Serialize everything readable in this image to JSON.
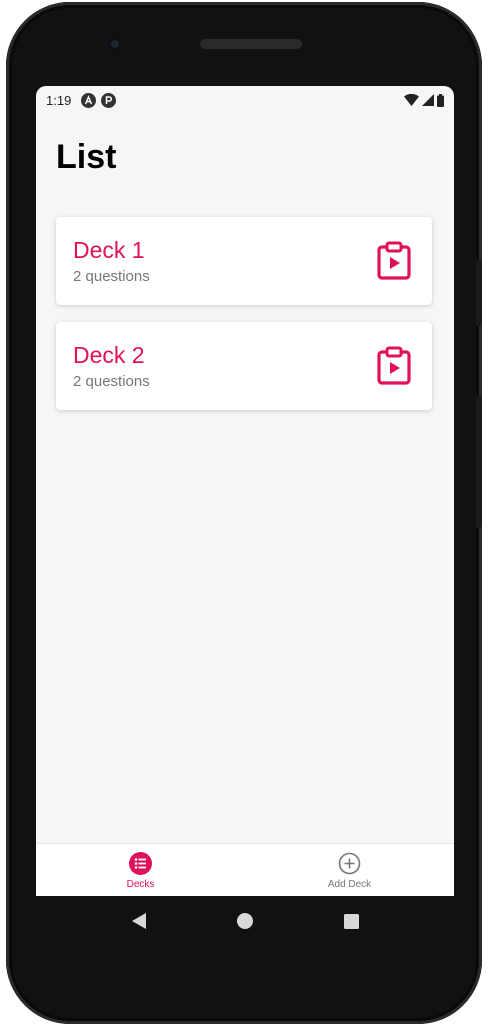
{
  "status_bar": {
    "time": "1:19"
  },
  "header": {
    "title": "List"
  },
  "decks": [
    {
      "title": "Deck 1",
      "subtitle": "2 questions"
    },
    {
      "title": "Deck 2",
      "subtitle": "2 questions"
    }
  ],
  "tabs": [
    {
      "label": "Decks",
      "icon": "list-icon",
      "active": true
    },
    {
      "label": "Add Deck",
      "icon": "add-circle-icon",
      "active": false
    }
  ],
  "colors": {
    "accent": "#e0105a",
    "inactive": "#777777",
    "background": "#f6f6f6"
  },
  "system_nav": {
    "back_icon": "back-triangle-icon",
    "home_icon": "home-circle-icon",
    "recents_icon": "recents-square-icon"
  }
}
